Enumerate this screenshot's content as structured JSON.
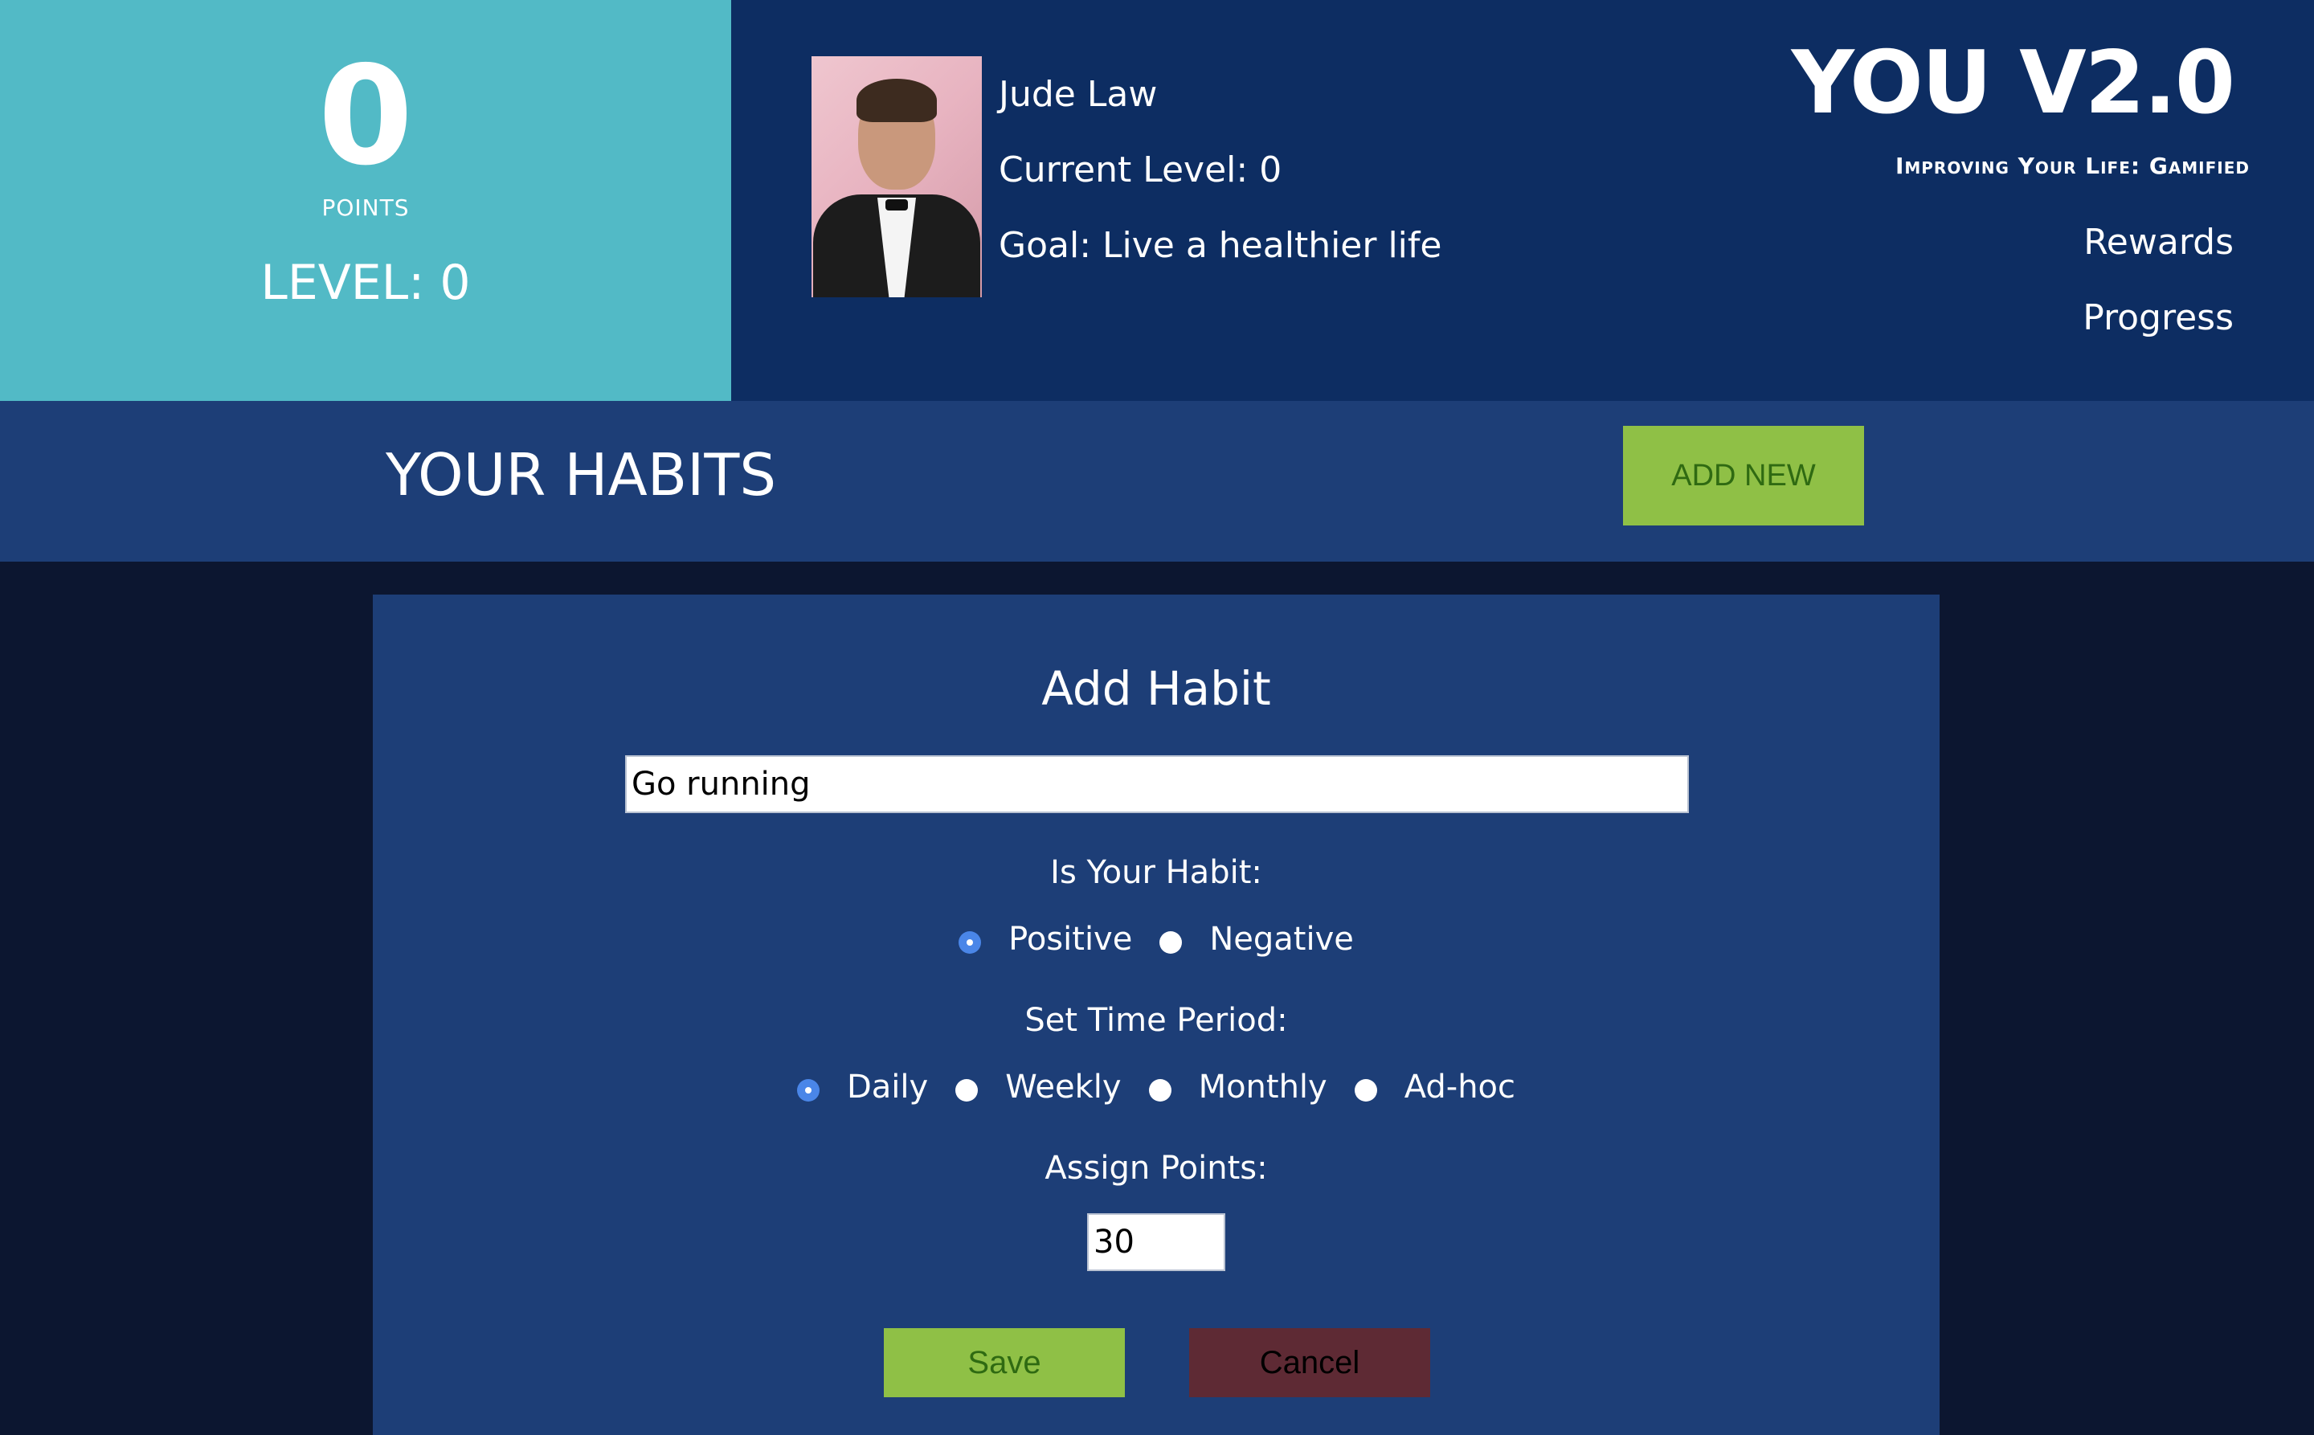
{
  "stats": {
    "points": "0",
    "points_label": "POINTS",
    "level": "LEVEL: 0"
  },
  "profile": {
    "name": "Jude Law",
    "current_level": "Current Level: 0",
    "goal": "Goal: Live a healthier life"
  },
  "brand": {
    "title": "YOU V2.0",
    "tagline": "Improving Your Life: Gamified"
  },
  "nav": {
    "rewards": "Rewards",
    "progress": "Progress"
  },
  "habits": {
    "title": "YOUR HABITS",
    "add_new": "ADD NEW"
  },
  "modal": {
    "title": "Add Habit",
    "habit_name_value": "Go running",
    "type_label": "Is Your Habit:",
    "type_options": [
      "Positive",
      "Negative"
    ],
    "type_selected": "Positive",
    "period_label": "Set Time Period:",
    "period_options": [
      "Daily",
      "Weekly",
      "Monthly",
      "Ad-hoc"
    ],
    "period_selected": "Daily",
    "points_label": "Assign Points:",
    "points_value": "30",
    "save": "Save",
    "cancel": "Cancel"
  },
  "colors": {
    "points_panel": "#52bac6",
    "profile_panel": "#0d2d62",
    "habits_bar": "#1d3e77",
    "page_background": "#0c1630",
    "accent_green": "#8fc046",
    "cancel_red": "#5e2a34",
    "radio_selected": "#4a86e8"
  }
}
